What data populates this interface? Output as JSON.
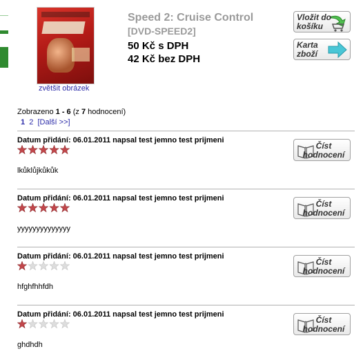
{
  "product": {
    "zoom_link": "zvětšit obrázek",
    "title": "Speed 2: Cruise Control",
    "code": "[DVD-SPEED2]",
    "price_with_vat": "50 Kč s DPH",
    "price_without_vat": "42 Kč bez DPH",
    "add_to_cart_label": "Vložit do košíku",
    "product_card_label": "Karta zboží"
  },
  "listing": {
    "shown_prefix": "Zobrazeno ",
    "shown_range": "1 - 6",
    "shown_mid": " (z ",
    "shown_total": "7",
    "shown_suffix": " hodnocení)",
    "pages": [
      "1",
      "2"
    ],
    "next_label": "[Další >>]"
  },
  "reviews": [
    {
      "header": "Datum přidání: 06.01.2011 napsal test jemno test prijmeni",
      "rating": 5,
      "max_rating": 5,
      "text": "lkůklůjkůkůk",
      "read_label": "Číst hodnocení"
    },
    {
      "header": "Datum přidání: 06.01.2011 napsal test jemno test prijmeni",
      "rating": 5,
      "max_rating": 5,
      "text": "yyyyyyyyyyyyyy",
      "read_label": "Číst hodnocení"
    },
    {
      "header": "Datum přidání: 06.01.2011 napsal test jemno test prijmeni",
      "rating": 1,
      "max_rating": 5,
      "text": "hfghfhhfdh",
      "read_label": "Číst hodnocení"
    },
    {
      "header": "Datum přidání: 06.01.2011 napsal test jemno test prijmeni",
      "rating": 1,
      "max_rating": 5,
      "text": "ghdhdh",
      "read_label": "Číst hodnocení"
    }
  ],
  "colors": {
    "star_filled": "#c2474b",
    "star_empty": "#dddddd",
    "link": "#2a2aa8",
    "title_gray": "#9a9a9a",
    "arrow_green": "#4fbf4f",
    "arrow_cyan": "#49c6d6"
  }
}
